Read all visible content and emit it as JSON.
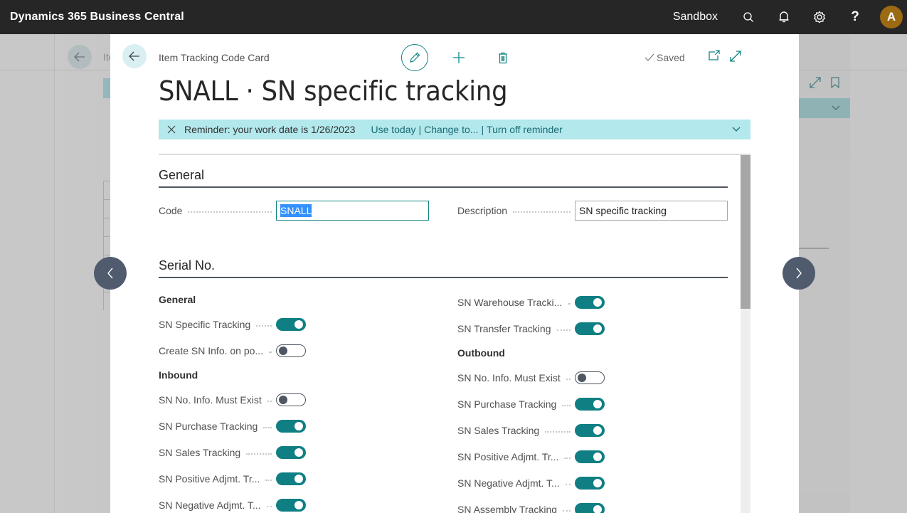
{
  "appbar": {
    "title": "Dynamics 365 Business Central",
    "environment": "Sandbox",
    "icons": [
      "search-icon",
      "bell-icon",
      "gear-icon",
      "help-icon"
    ],
    "avatar_initial": "A",
    "avatar_color": "#9b6a12"
  },
  "background_page": {
    "caption_fragment": "Ite"
  },
  "card": {
    "caption": "Item Tracking Code Card",
    "title": "SNALL · SN specific tracking",
    "saved_label": "Saved",
    "toolbar_icons": [
      "pencil-icon",
      "plus-icon",
      "trash-icon"
    ],
    "tool_icons": [
      "open-new-window-icon",
      "expand-icon"
    ],
    "accent_color": "#0f7f83"
  },
  "reminder": {
    "message": "Reminder: your work date is 1/26/2023",
    "links": [
      "Use today",
      "Change to...",
      "Turn off reminder"
    ],
    "separator": "|",
    "background": "#b3e8ec"
  },
  "general": {
    "heading": "General",
    "code_label": "Code",
    "code_value": "SNALL",
    "description_label": "Description",
    "description_value": "SN specific tracking"
  },
  "serial": {
    "heading": "Serial No.",
    "left": {
      "general_heading": "General",
      "general_items": [
        {
          "label": "SN Specific Tracking",
          "on": true
        },
        {
          "label": "Create SN Info. on po...",
          "on": false
        }
      ],
      "inbound_heading": "Inbound",
      "inbound_items": [
        {
          "label": "SN No. Info. Must Exist",
          "on": false
        },
        {
          "label": "SN Purchase Tracking",
          "on": true
        },
        {
          "label": "SN Sales Tracking",
          "on": true
        },
        {
          "label": "SN Positive Adjmt. Tr...",
          "on": true
        },
        {
          "label": "SN Negative Adjmt. T...",
          "on": true
        }
      ]
    },
    "right": {
      "top_items": [
        {
          "label": "SN Warehouse Tracki...",
          "on": true
        },
        {
          "label": "SN Transfer Tracking",
          "on": true
        }
      ],
      "outbound_heading": "Outbound",
      "outbound_items": [
        {
          "label": "SN No. Info. Must Exist",
          "on": false
        },
        {
          "label": "SN Purchase Tracking",
          "on": true
        },
        {
          "label": "SN Sales Tracking",
          "on": true
        },
        {
          "label": "SN Positive Adjmt. Tr...",
          "on": true
        },
        {
          "label": "SN Negative Adjmt. T...",
          "on": true
        },
        {
          "label": "SN Assembly Tracking",
          "on": true
        }
      ]
    }
  },
  "navigation": {
    "previous_icon": "chevron-left-icon",
    "next_icon": "chevron-right-icon"
  }
}
